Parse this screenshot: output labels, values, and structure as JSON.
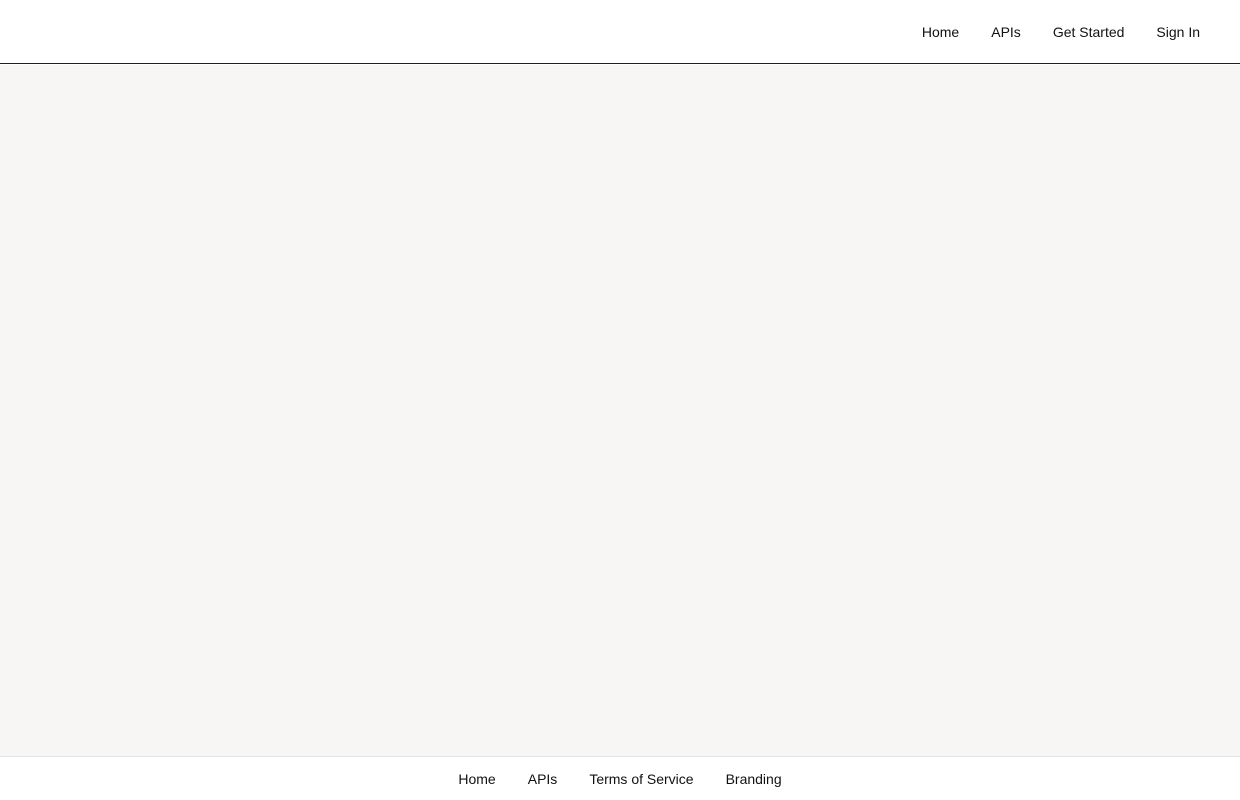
{
  "header": {
    "nav": {
      "home": "Home",
      "apis": "APIs",
      "get_started": "Get Started",
      "sign_in": "Sign In"
    }
  },
  "footer": {
    "nav": {
      "home": "Home",
      "apis": "APIs",
      "terms": "Terms of Service",
      "branding": "Branding"
    }
  },
  "colors": {
    "header_bg": "#ffffff",
    "main_bg": "#f7f6f4",
    "text": "#111111"
  }
}
